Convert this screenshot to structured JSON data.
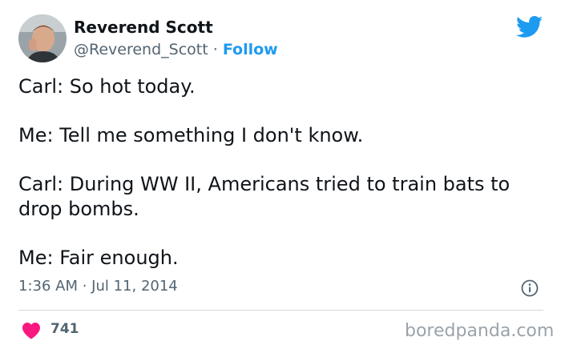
{
  "author": {
    "name": "Reverend Scott",
    "handle": "@Reverend_Scott",
    "separator": "·",
    "follow_label": "Follow"
  },
  "tweet": {
    "lines": [
      "Carl: So hot today.",
      "Me: Tell me something I don't know.",
      "Carl: During WW II, Americans tried to train bats to drop bombs.",
      "Me: Fair enough."
    ],
    "timestamp": "1:36 AM · Jul 11, 2014",
    "likes": "741"
  },
  "icons": {
    "logo": "twitter-bird-icon",
    "info": "info-icon",
    "like": "heart-icon"
  },
  "colors": {
    "accent": "#1d9bf0",
    "like": "#f91880",
    "muted": "#536471"
  },
  "watermark": "boredpanda.com"
}
